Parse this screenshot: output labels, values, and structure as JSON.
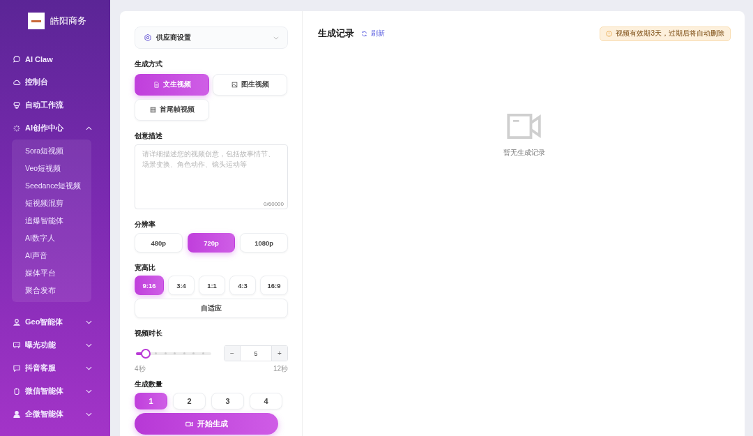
{
  "sidebar": {
    "brand": "皓阳商务",
    "items": [
      {
        "label": "AI Claw",
        "selected": false
      },
      {
        "label": "控制台",
        "selected": false
      },
      {
        "label": "自动工作流",
        "selected": false
      },
      {
        "label": "AI创作中心",
        "selected": false,
        "expanded": true,
        "children": [
          {
            "label": "Sora短视频",
            "selected": false
          },
          {
            "label": "Veo短视频",
            "selected": false
          },
          {
            "label": "Seedance短视频",
            "selected": false
          },
          {
            "label": "短视频混剪",
            "selected": false
          },
          {
            "label": "追爆智能体",
            "selected": false
          },
          {
            "label": "AI数字人",
            "selected": false
          },
          {
            "label": "AI声音",
            "selected": false
          },
          {
            "label": "媒体平台",
            "selected": false
          },
          {
            "label": "聚合发布",
            "selected": false
          }
        ]
      },
      {
        "label": "Geo智能体",
        "selected": false,
        "expanded": false
      },
      {
        "label": "曝光功能",
        "selected": false,
        "expanded": false
      },
      {
        "label": "抖音客服",
        "selected": false,
        "expanded": false
      },
      {
        "label": "微信智能体",
        "selected": false,
        "expanded": false
      },
      {
        "label": "企微智能体",
        "selected": false,
        "expanded": false
      }
    ]
  },
  "settings": {
    "provider": "供应商设置",
    "mode": {
      "label": "生成方式",
      "options": [
        {
          "label": "文生视频",
          "selected": true
        },
        {
          "label": "图生视频",
          "selected": false
        },
        {
          "label": "首尾帧视频",
          "selected": false
        }
      ]
    },
    "description": {
      "label": "创意描述",
      "placeholder": "请详细描述您的视频创意，包括故事情节、场景变换、角色动作、镜头运动等",
      "counter": "0/60000"
    },
    "resolution": {
      "label": "分辨率",
      "options": [
        {
          "label": "480p",
          "selected": false
        },
        {
          "label": "720p",
          "selected": true
        },
        {
          "label": "1080p",
          "selected": false
        }
      ]
    },
    "aspect": {
      "label": "宽高比",
      "options": [
        {
          "label": "9:16",
          "selected": true
        },
        {
          "label": "3:4",
          "selected": false
        },
        {
          "label": "1:1",
          "selected": false
        },
        {
          "label": "4:3",
          "selected": false
        },
        {
          "label": "16:9",
          "selected": false
        }
      ],
      "auto": {
        "label": "自适应",
        "selected": false
      }
    },
    "duration": {
      "label": "视频时长",
      "level": 0.125,
      "min": "4秒",
      "max": "12秒",
      "value": "5",
      "minus": "−",
      "plus": "+"
    },
    "count": {
      "label": "生成数量",
      "options": [
        {
          "label": "1",
          "selected": true
        },
        {
          "label": "2",
          "selected": false
        },
        {
          "label": "3",
          "selected": false
        },
        {
          "label": "4",
          "selected": false
        }
      ]
    },
    "generate": "开始生成"
  },
  "records": {
    "title": "生成记录",
    "refresh": "刷新",
    "notice": "视频有效期3天，过期后将自动删除",
    "empty": "暂无生成记录"
  }
}
